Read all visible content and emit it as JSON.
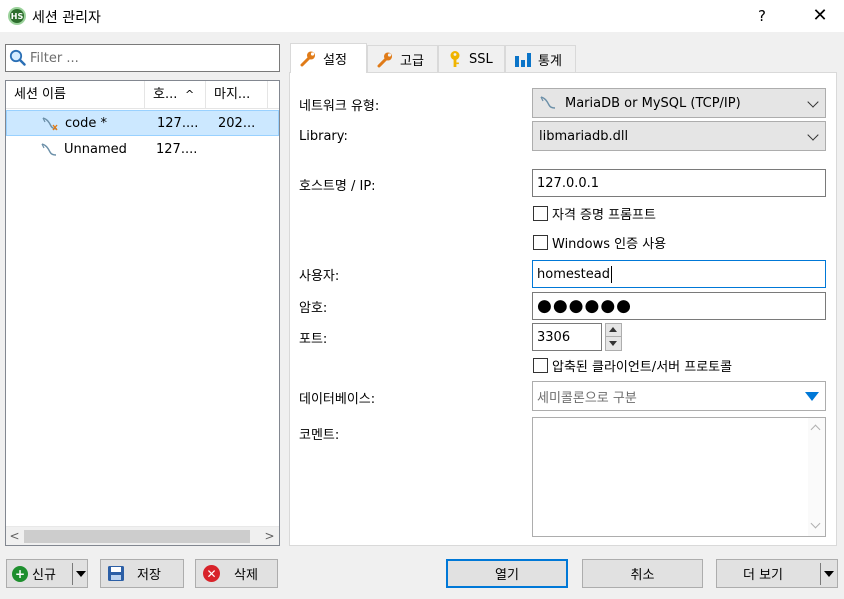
{
  "window": {
    "app_icon_text": "HS",
    "title": "세션 관리자",
    "help_label": "?",
    "close_label": "✕"
  },
  "filter": {
    "placeholder": "Filter ...",
    "value": ""
  },
  "session_list": {
    "columns": [
      "세션 이름",
      "호...",
      "마지..."
    ],
    "sort_indicator": "^",
    "rows": [
      {
        "name": "code *",
        "host": "127....",
        "last": "202...",
        "selected": true
      },
      {
        "name": "Unnamed",
        "host": "127....",
        "last": "",
        "selected": false
      }
    ],
    "scroll_left": "<",
    "scroll_right": ">"
  },
  "left_buttons": {
    "new_label": "신규",
    "save_label": "저장",
    "delete_label": "삭제"
  },
  "tabs": [
    {
      "label": "설정",
      "icon": "wrench-icon",
      "active": true
    },
    {
      "label": "고급",
      "icon": "wrench-icon",
      "active": false
    },
    {
      "label": "SSL",
      "icon": "key-icon",
      "active": false
    },
    {
      "label": "통계",
      "icon": "bar-chart-icon",
      "active": false
    }
  ],
  "form": {
    "network_type_label": "네트워크 유형:",
    "network_type_value": "MariaDB or MySQL (TCP/IP)",
    "library_label": "Library:",
    "library_value": "libmariadb.dll",
    "host_label": "호스트명 / IP:",
    "host_value": "127.0.0.1",
    "prompt_credentials_label": "자격 증명 프롬프트",
    "prompt_credentials_checked": false,
    "windows_auth_label": "Windows 인증 사용",
    "windows_auth_checked": false,
    "user_label": "사용자:",
    "user_value": "homestead",
    "password_label": "암호:",
    "password_value": "●●●●●●",
    "port_label": "포트:",
    "port_value": "3306",
    "compressed_label": "압축된 클라이언트/서버 프로토콜",
    "compressed_checked": false,
    "databases_label": "데이터베이스:",
    "databases_placeholder": "세미콜론으로 구분",
    "comment_label": "코멘트:",
    "comment_value": ""
  },
  "bottom_buttons": {
    "open_label": "열기",
    "cancel_label": "취소",
    "more_label": "더 보기"
  },
  "colors": {
    "selection_bg": "#cce8ff",
    "accent": "#0078d7",
    "new_icon": "#1e8f2e",
    "delete_icon": "#d8232a",
    "wrench": "#e07b18",
    "key": "#f0b400",
    "chart": "#0b74c8"
  }
}
